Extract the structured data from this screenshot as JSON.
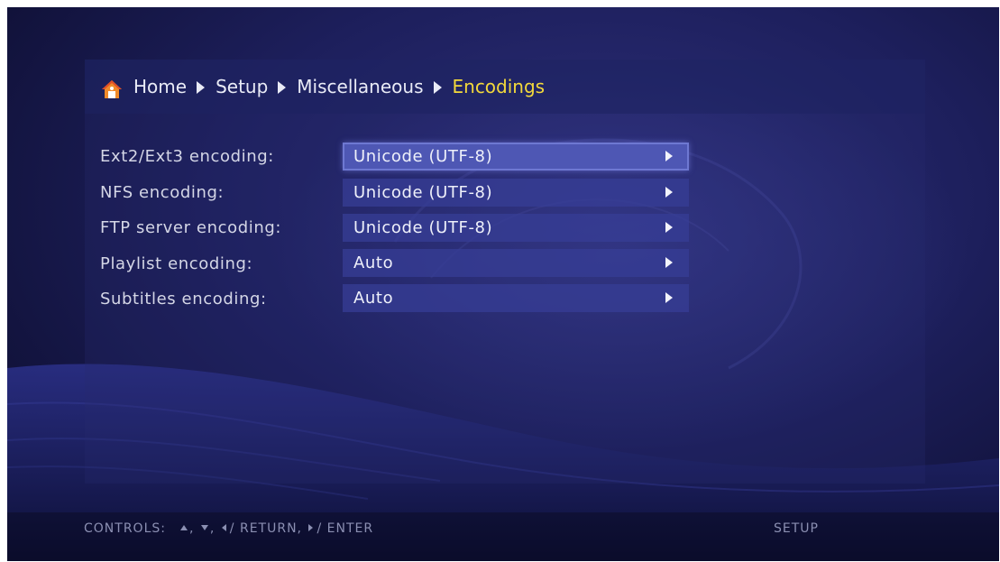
{
  "breadcrumb": {
    "items": [
      "Home",
      "Setup",
      "Miscellaneous",
      "Encodings"
    ],
    "current_index": 3
  },
  "settings": [
    {
      "label": "Ext2/Ext3 encoding:",
      "value": "Unicode (UTF-8)",
      "selected": true
    },
    {
      "label": "NFS encoding:",
      "value": "Unicode (UTF-8)",
      "selected": false
    },
    {
      "label": "FTP server encoding:",
      "value": "Unicode (UTF-8)",
      "selected": false
    },
    {
      "label": "Playlist encoding:",
      "value": "Auto",
      "selected": false
    },
    {
      "label": "Subtitles encoding:",
      "value": "Auto",
      "selected": false
    }
  ],
  "footer": {
    "controls_label": "CONTROLS:",
    "return_label": "/ RETURN,",
    "enter_label": "/ ENTER",
    "section_label": "SETUP"
  },
  "icons": {
    "home": "home-icon",
    "breadcrumb_separator": "chevron-right-icon",
    "row_arrow": "chevron-right-icon"
  },
  "colors": {
    "current_crumb": "#f3d93b",
    "selected_row": "#4e57b4",
    "row_background": "#373e96"
  }
}
